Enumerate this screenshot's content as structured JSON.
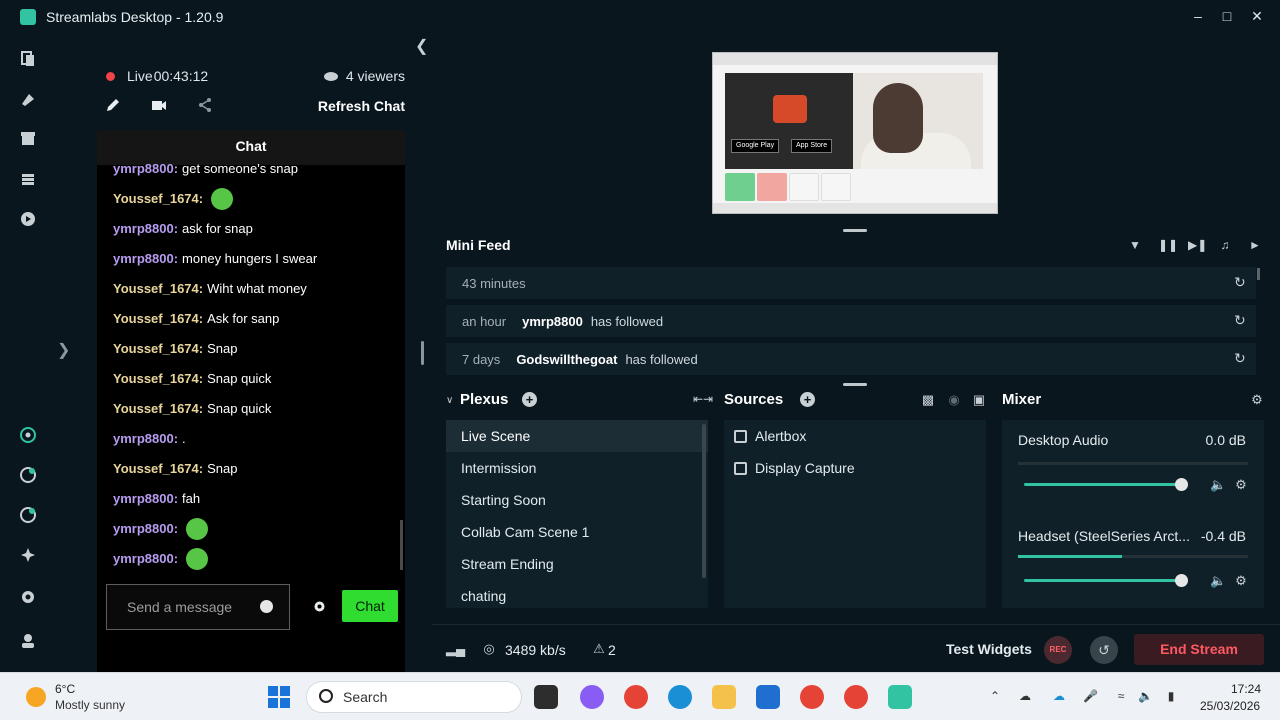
{
  "window": {
    "title": "Streamlabs Desktop - 1.20.9"
  },
  "stream": {
    "live_label": "Live",
    "duration": "00:43:12",
    "viewers": "4 viewers",
    "refresh_label": "Refresh Chat"
  },
  "chat": {
    "title": "Chat",
    "messages": [
      {
        "user": "ymrp8800:",
        "text": "get someone's snap",
        "color": "purple",
        "emote": false
      },
      {
        "user": "Youssef_1674:",
        "text": "",
        "color": "yellow",
        "emote": true
      },
      {
        "user": "ymrp8800:",
        "text": "ask for snap",
        "color": "purple",
        "emote": false
      },
      {
        "user": "ymrp8800:",
        "text": "money hungers I swear",
        "color": "purple",
        "emote": false
      },
      {
        "user": "Youssef_1674:",
        "text": "Wiht what money",
        "color": "yellow",
        "emote": false
      },
      {
        "user": "Youssef_1674:",
        "text": "Ask for sanp",
        "color": "yellow",
        "emote": false
      },
      {
        "user": "Youssef_1674:",
        "text": "Snap",
        "color": "yellow",
        "emote": false
      },
      {
        "user": "Youssef_1674:",
        "text": "Snap quick",
        "color": "yellow",
        "emote": false
      },
      {
        "user": "Youssef_1674:",
        "text": "Snap quick",
        "color": "yellow",
        "emote": false
      },
      {
        "user": "ymrp8800:",
        "text": ".",
        "color": "purple",
        "emote": false
      },
      {
        "user": "Youssef_1674:",
        "text": "Snap",
        "color": "yellow",
        "emote": false
      },
      {
        "user": "ymrp8800:",
        "text": "fah",
        "color": "purple",
        "emote": false
      },
      {
        "user": "ymrp8800:",
        "text": "",
        "color": "purple",
        "emote": true
      },
      {
        "user": "ymrp8800:",
        "text": "",
        "color": "purple",
        "emote": true
      }
    ],
    "input_placeholder": "Send a message",
    "send_label": "Chat"
  },
  "preview": {
    "google_play": "Google Play",
    "app_store": "App Store"
  },
  "mini_feed": {
    "title": "Mini Feed",
    "items": [
      {
        "time": "43 minutes",
        "user": "",
        "action": ""
      },
      {
        "time": "an hour",
        "user": "ymrp8800",
        "action": "has followed"
      },
      {
        "time": "7 days",
        "user": "Godswillthegoat",
        "action": "has followed"
      }
    ]
  },
  "scenes": {
    "title": "Plexus",
    "items": [
      "Live Scene",
      "Intermission",
      "Starting Soon",
      "Collab Cam Scene 1",
      "Stream Ending",
      "chating"
    ],
    "active_index": 0
  },
  "sources": {
    "title": "Sources",
    "items": [
      "Alertbox",
      "Display Capture"
    ]
  },
  "mixer": {
    "title": "Mixer",
    "channels": [
      {
        "name": "Desktop Audio",
        "db": "0.0 dB",
        "meter_level": 0,
        "volume": 1.0
      },
      {
        "name": "Headset (SteelSeries Arct...",
        "db": "-0.4 dB",
        "meter_level": 0.45,
        "volume": 1.0
      }
    ]
  },
  "status_bar": {
    "bitrate": "3489 kb/s",
    "alerts": "2",
    "test_widgets": "Test Widgets",
    "rec": "REC",
    "end_stream": "End Stream"
  },
  "taskbar": {
    "temp": "6°C",
    "weather": "Mostly sunny",
    "search": "Search",
    "time": "17:24",
    "date": "25/03/2026"
  },
  "colors": {
    "accent": "#31c3a2",
    "live": "#f0434a",
    "chat_send": "#2fdc2f",
    "end_stream": "#ff5a63"
  }
}
